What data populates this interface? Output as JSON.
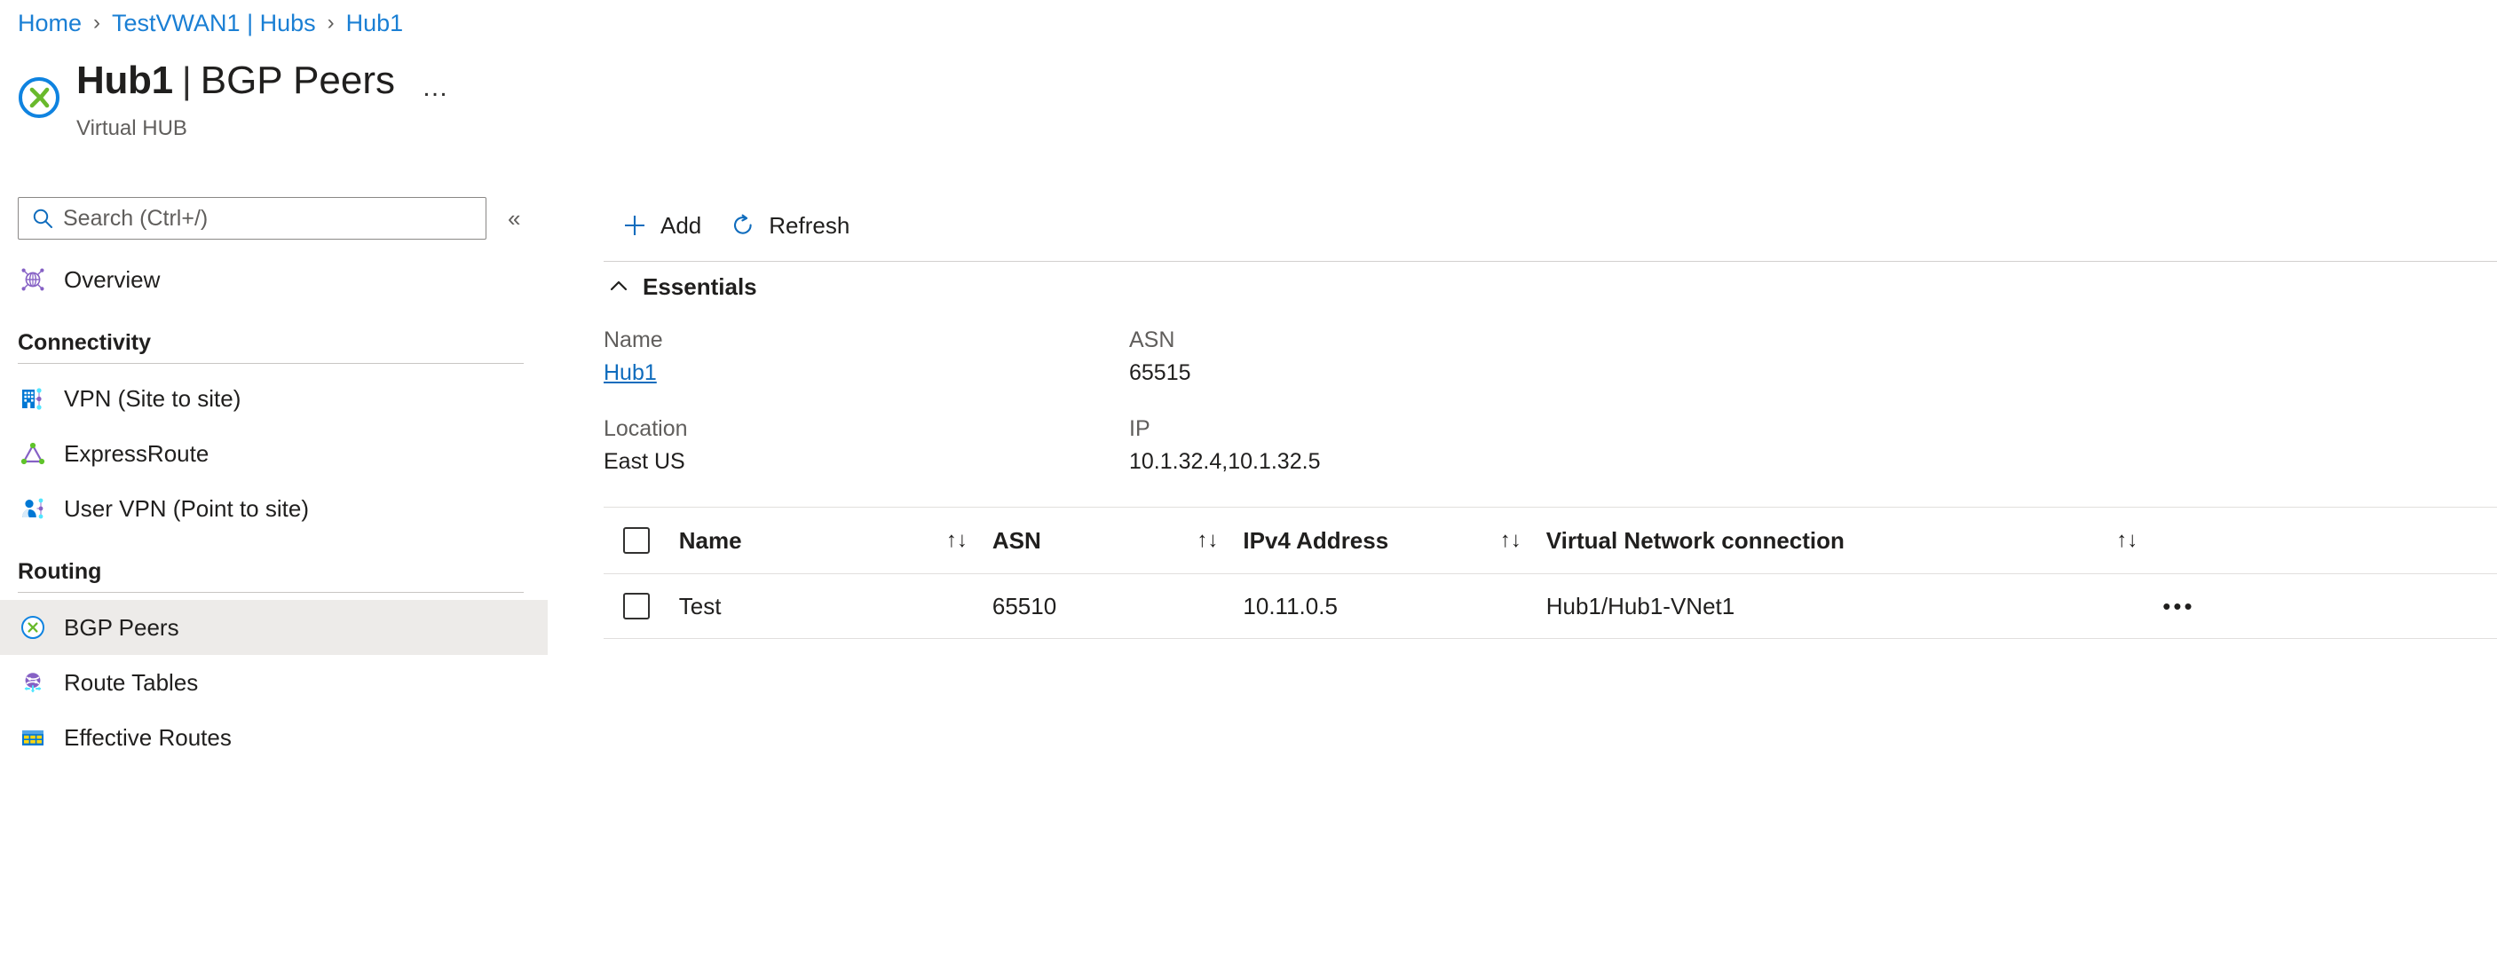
{
  "breadcrumb": {
    "items": [
      {
        "label": "Home"
      },
      {
        "label": "TestVWAN1 | Hubs"
      },
      {
        "label": "Hub1"
      }
    ],
    "separator": "›"
  },
  "header": {
    "resource_name": "Hub1",
    "separator": "|",
    "page_name": "BGP Peers",
    "subtitle": "Virtual HUB",
    "more_menu": "…",
    "icon": "virtual-hub-icon"
  },
  "sidebar": {
    "search": {
      "placeholder": "Search (Ctrl+/)",
      "value": "",
      "icon": "search-icon"
    },
    "collapse": "«",
    "top_items": [
      {
        "label": "Overview",
        "icon": "overview-globe-icon",
        "selected": false
      }
    ],
    "groups": [
      {
        "title": "Connectivity",
        "items": [
          {
            "label": "VPN (Site to site)",
            "icon": "vpn-site-to-site-icon",
            "selected": false
          },
          {
            "label": "ExpressRoute",
            "icon": "expressroute-icon",
            "selected": false
          },
          {
            "label": "User VPN (Point to site)",
            "icon": "user-vpn-icon",
            "selected": false
          }
        ]
      },
      {
        "title": "Routing",
        "items": [
          {
            "label": "BGP Peers",
            "icon": "bgp-peers-icon",
            "selected": true
          },
          {
            "label": "Route Tables",
            "icon": "route-tables-icon",
            "selected": false
          },
          {
            "label": "Effective Routes",
            "icon": "effective-routes-icon",
            "selected": false
          }
        ]
      }
    ]
  },
  "toolbar": {
    "add_label": "Add",
    "add_icon": "plus-icon",
    "refresh_label": "Refresh",
    "refresh_icon": "refresh-icon"
  },
  "essentials": {
    "title": "Essentials",
    "chevron": "collapse-chevron-up-icon",
    "fields": [
      {
        "label": "Name",
        "value": "Hub1",
        "is_link": true
      },
      {
        "label": "ASN",
        "value": "65515",
        "is_link": false
      },
      {
        "label": "Location",
        "value": "East US",
        "is_link": false
      },
      {
        "label": "IP",
        "value": "10.1.32.4,10.1.32.5",
        "is_link": false
      }
    ]
  },
  "table": {
    "sort_icon": "↑↓",
    "columns": [
      {
        "key": "name",
        "label": "Name",
        "sortable": true
      },
      {
        "key": "asn",
        "label": "ASN",
        "sortable": true
      },
      {
        "key": "ipv4",
        "label": "IPv4 Address",
        "sortable": true
      },
      {
        "key": "vnet",
        "label": "Virtual Network connection",
        "sortable": true
      }
    ],
    "rows": [
      {
        "name": "Test",
        "asn": "65510",
        "ipv4": "10.11.0.5",
        "vnet": "Hub1/Hub1-VNet1",
        "actions": "•••"
      }
    ]
  },
  "colors": {
    "link": "#1a7fd4",
    "accent_blue": "#0f6cbd",
    "selected_nav_bg": "#edebe9",
    "text_primary": "#201f1e",
    "text_secondary": "#605e5c",
    "divider": "#e1dfdd"
  }
}
